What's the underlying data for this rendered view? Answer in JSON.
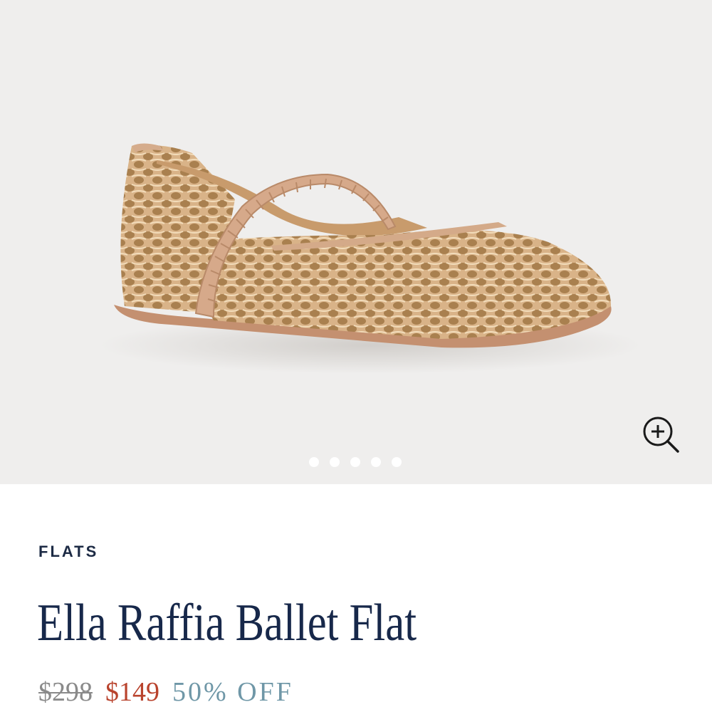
{
  "gallery": {
    "image_alt": "Ella Raffia Ballet Flat product photo",
    "slide_count": 5,
    "active_slide": 1,
    "zoom_icon": "zoom-in-icon"
  },
  "product": {
    "category": "FLATS",
    "name": "Ella Raffia Ballet Flat",
    "price_original": "$298",
    "price_sale": "$149",
    "discount": "50% OFF"
  },
  "colors": {
    "background": "#efeeed",
    "title": "#17284a",
    "sale": "#b9432d",
    "discount": "#6f97a7"
  }
}
